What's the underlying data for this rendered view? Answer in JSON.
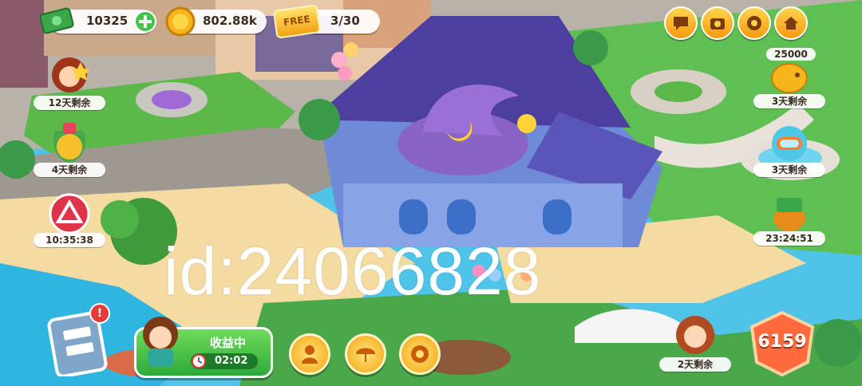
{
  "hud": {
    "cash": "10325",
    "coins": "802.88k",
    "free_badge": "FREE",
    "free_spins": "3/30",
    "piggy_amount": "25000"
  },
  "events_left": [
    {
      "label": "12天剩余",
      "icon": "chef-girl-icon"
    },
    {
      "label": "4天剩余",
      "icon": "gold-bell-icon"
    },
    {
      "label": "10:35:38",
      "icon": "game-triangle-icon"
    }
  ],
  "events_right": [
    {
      "label": "3天剩余",
      "icon": "piggy-bank-icon"
    },
    {
      "label": "3天剩余",
      "icon": "diving-mask-icon"
    },
    {
      "label": "23:24:51",
      "icon": "cash-pot-icon"
    }
  ],
  "top_right_buttons": [
    "chat-icon",
    "camera-icon",
    "settings-icon",
    "home-icon"
  ],
  "income": {
    "status": "收益中",
    "timer": "02:02"
  },
  "bottom_actions": [
    "staff-icon",
    "umbrella-icon",
    "cafe-icon"
  ],
  "bottom_right_event": {
    "label": "2天剩余"
  },
  "level_gem": "6159",
  "watermark": "id:24066828",
  "colors": {
    "accent": "#f59a12",
    "green": "#3ec14a",
    "gem": "#ff5a3c"
  }
}
